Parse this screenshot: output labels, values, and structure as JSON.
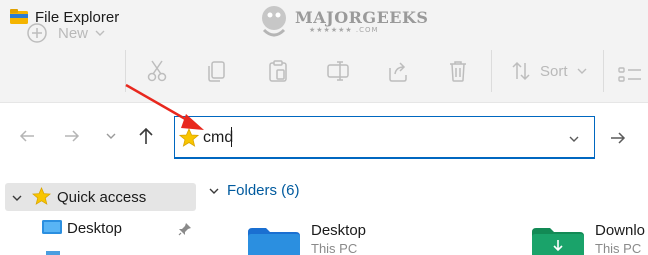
{
  "window": {
    "title": "File Explorer"
  },
  "watermark": {
    "text": "MAJORGEEKS",
    "sub": "★★★★★★ .COM"
  },
  "toolbar": {
    "new_label": "New",
    "sort_label": "Sort"
  },
  "address": {
    "value": "cmd"
  },
  "nav": {
    "quick_access_label": "Quick access",
    "desktop_label": "Desktop"
  },
  "content": {
    "folders_header": "Folders (6)",
    "items": [
      {
        "name": "Desktop",
        "location": "This PC"
      },
      {
        "name": "Downlo",
        "location": "This PC"
      }
    ]
  },
  "colors": {
    "accent": "#0067c0",
    "folder_blue": "#1e90ff",
    "folder_green": "#1aa36a",
    "star": "#f8c500",
    "arrow": "#e8281e"
  }
}
